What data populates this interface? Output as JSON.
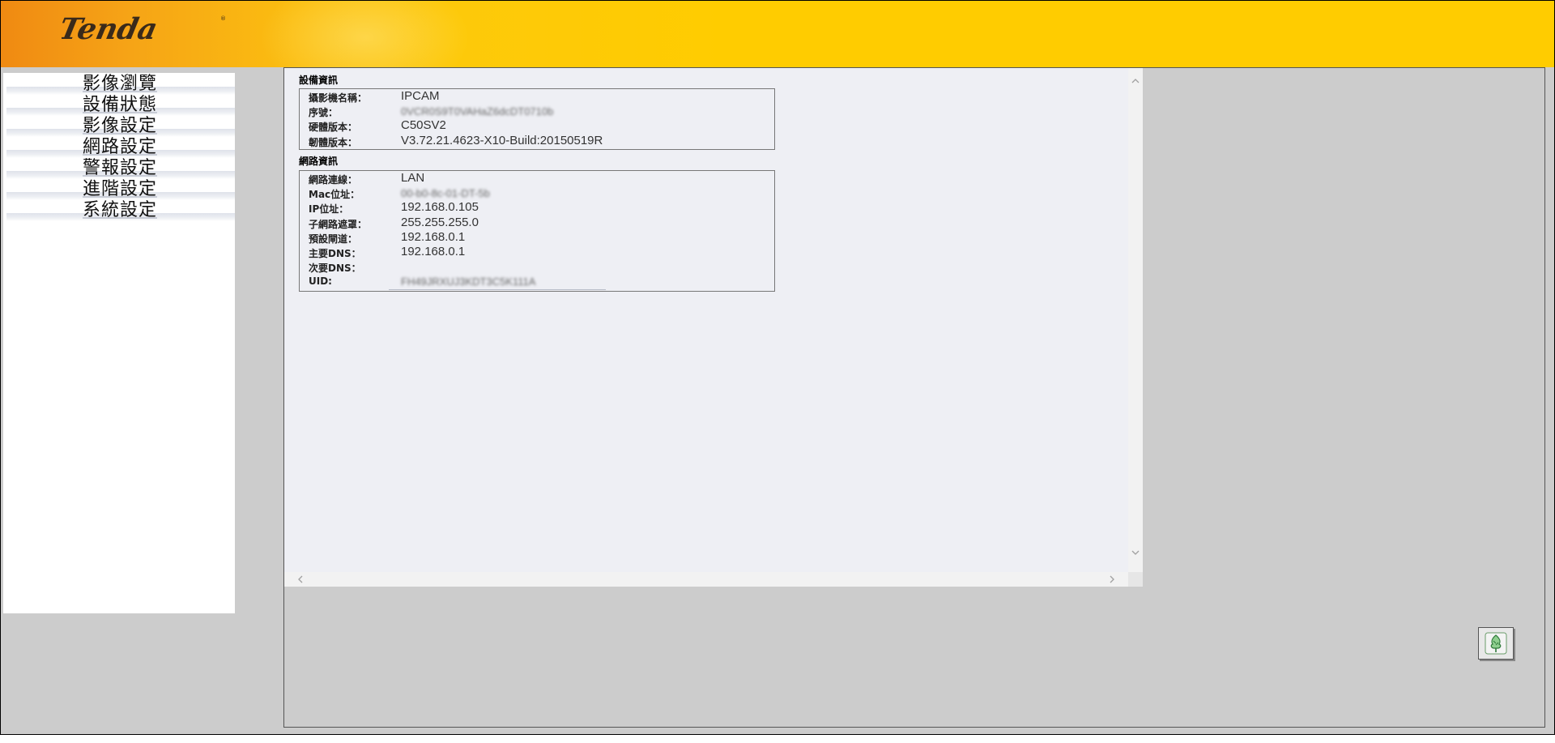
{
  "brand": {
    "logo_text": "Tenda"
  },
  "nav": {
    "items": [
      {
        "label": "影像瀏覽"
      },
      {
        "label": "設備狀態"
      },
      {
        "label": "影像設定"
      },
      {
        "label": "網路設定"
      },
      {
        "label": "警報設定"
      },
      {
        "label": "進階設定"
      },
      {
        "label": "系統設定"
      }
    ]
  },
  "device_info": {
    "title": "設備資訊",
    "rows": [
      {
        "label": "攝影機名稱：",
        "value": "IPCAM"
      },
      {
        "label": "序號：",
        "value": "0VCR0S9T0VAHaZ6dcDT0710b"
      },
      {
        "label": "硬體版本：",
        "value": "C50SV2"
      },
      {
        "label": "韌體版本：",
        "value": "V3.72.21.4623-X10-Build:20150519R"
      }
    ]
  },
  "network_info": {
    "title": "網路資訊",
    "rows": [
      {
        "label": "網路連線：",
        "value": "LAN"
      },
      {
        "label": "Mac位址：",
        "value": "00-b0-8c-01-DT-5b"
      },
      {
        "label": "IP位址：",
        "value": "192.168.0.105"
      },
      {
        "label": "子網路遮罩：",
        "value": "255.255.255.0"
      },
      {
        "label": "預設閘道：",
        "value": "192.168.0.1"
      },
      {
        "label": "主要DNS：",
        "value": "192.168.0.1"
      },
      {
        "label": "次要DNS：",
        "value": ""
      },
      {
        "label": "UID:",
        "value": "FH49JRXUJ3KDT3C5K111A"
      }
    ]
  },
  "icons": {
    "tree_button": "tree-icon",
    "scroll_up": "chevron-up-icon",
    "scroll_down": "chevron-down-icon",
    "scroll_left": "chevron-left-icon",
    "scroll_right": "chevron-right-icon"
  },
  "colors": {
    "header_orange": "#f08a12",
    "header_yellow": "#ffcc00",
    "panel_bg": "#eeeff4",
    "frame_bg": "#cccccc"
  }
}
